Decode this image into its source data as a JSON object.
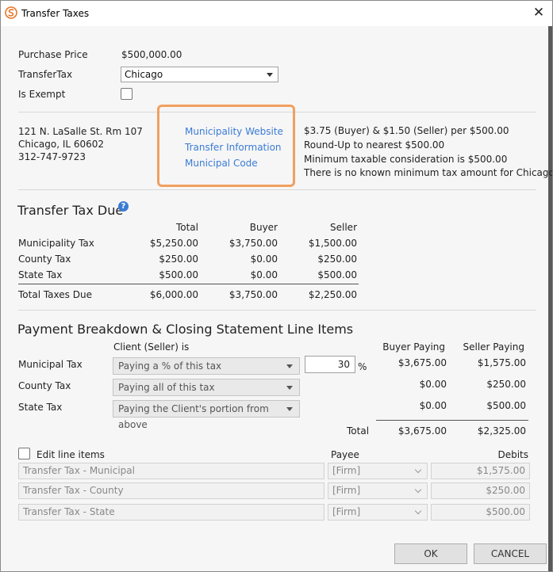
{
  "window": {
    "title": "Transfer Taxes"
  },
  "colors": {
    "accent_link": "#3a7bd5",
    "highlight_box": "#f0a060",
    "logo": "#e8762b"
  },
  "header": {
    "purchase_price_label": "Purchase Price",
    "purchase_price_value": "$500,000.00",
    "transfer_tax_label": "TransferTax",
    "transfer_tax_selected": "Chicago",
    "is_exempt_label": "Is Exempt"
  },
  "municipality": {
    "address_line1": "121 N. LaSalle St. Rm 107",
    "address_line2": "Chicago, IL 60602",
    "phone": "312-747-9723",
    "links": [
      "Municipality Website",
      "Transfer Information",
      "Municipal Code"
    ],
    "info": [
      "$3.75 (Buyer) & $1.50 (Seller) per $500.00",
      "Round-Up to nearest $500.00",
      "Minimum taxable consideration is $500.00",
      "There is no known minimum tax amount for Chicago"
    ]
  },
  "tax_due": {
    "title": "Transfer Tax Due",
    "columns": [
      "Total",
      "Buyer",
      "Seller"
    ],
    "rows": [
      {
        "label": "Municipality Tax",
        "total": "$5,250.00",
        "buyer": "$3,750.00",
        "seller": "$1,500.00"
      },
      {
        "label": "County Tax",
        "total": "$250.00",
        "buyer": "$0.00",
        "seller": "$250.00"
      },
      {
        "label": "State Tax",
        "total": "$500.00",
        "buyer": "$0.00",
        "seller": "$500.00"
      }
    ],
    "total_row": {
      "label": "Total Taxes Due",
      "total": "$6,000.00",
      "buyer": "$3,750.00",
      "seller": "$2,250.00"
    }
  },
  "breakdown": {
    "title": "Payment Breakdown & Closing Statement Line Items",
    "client_header": "Client (Seller) is",
    "buyer_header": "Buyer Paying",
    "seller_header": "Seller Paying",
    "rows": [
      {
        "label": "Municipal Tax",
        "option": "Paying a % of this tax",
        "percent": "30",
        "percent_symbol": "%",
        "buyer": "$3,675.00",
        "seller": "$1,575.00"
      },
      {
        "label": "County Tax",
        "option": "Paying all of this tax",
        "buyer": "$0.00",
        "seller": "$250.00"
      },
      {
        "label": "State Tax",
        "option": "Paying the Client's portion from above",
        "buyer": "$0.00",
        "seller": "$500.00"
      }
    ],
    "total_label": "Total",
    "total_buyer": "$3,675.00",
    "total_seller": "$2,325.00"
  },
  "line_items": {
    "edit_label": "Edit line items",
    "payee_header": "Payee",
    "debits_header": "Debits",
    "rows": [
      {
        "name": "Transfer Tax - Municipal",
        "payee": "[Firm]",
        "debit": "$1,575.00"
      },
      {
        "name": "Transfer Tax - County",
        "payee": "[Firm]",
        "debit": "$250.00"
      },
      {
        "name": "Transfer Tax - State",
        "payee": "[Firm]",
        "debit": "$500.00"
      }
    ]
  },
  "footer": {
    "ok": "OK",
    "cancel": "CANCEL"
  }
}
